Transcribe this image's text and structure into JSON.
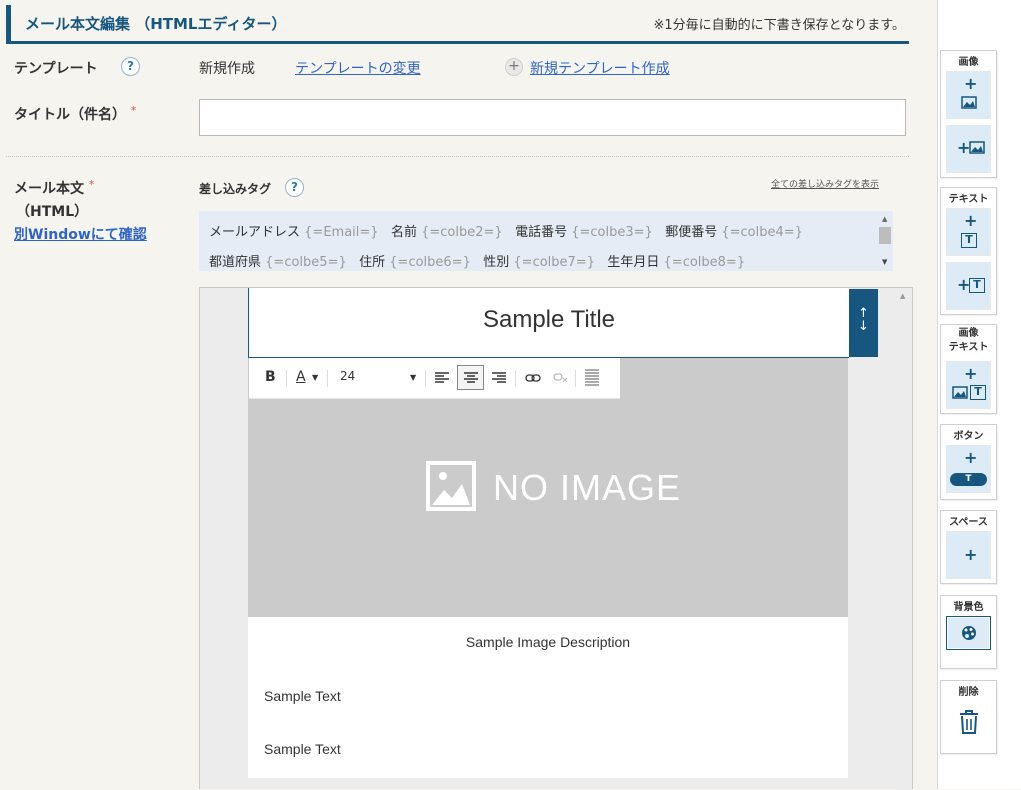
{
  "header": {
    "title": "メール本文編集 （HTMLエディター）",
    "note": "※1分毎に自動的に下書き保存となります。"
  },
  "template": {
    "label": "テンプレート",
    "current": "新規作成",
    "change_link": "テンプレートの変更",
    "new_link": "新規テンプレート作成"
  },
  "title_field": {
    "label": "タイトル（件名）",
    "required": "*",
    "value": ""
  },
  "body": {
    "label": "メール本文",
    "required": "*",
    "sublabel": "（HTML）",
    "preview_link": "別Windowにて確認",
    "tags_label": "差し込みタグ",
    "show_all_link": "全ての差し込みタグを表示",
    "tags": [
      {
        "name": "メールアドレス",
        "code": "{=Email=}"
      },
      {
        "name": "名前",
        "code": "{=colbe2=}"
      },
      {
        "name": "電話番号",
        "code": "{=colbe3=}"
      },
      {
        "name": "郵便番号",
        "code": "{=colbe4=}"
      },
      {
        "name": "都道府県",
        "code": "{=colbe5=}"
      },
      {
        "name": "住所",
        "code": "{=colbe6=}"
      },
      {
        "name": "性別",
        "code": "{=colbe7=}"
      },
      {
        "name": "生年月日",
        "code": "{=colbe8=}"
      }
    ]
  },
  "editor": {
    "sample_title": "Sample Title",
    "font_size": "24",
    "no_image": "NO IMAGE",
    "image_description": "Sample Image Description",
    "sample_text_1": "Sample Text",
    "sample_text_2": "Sample Text"
  },
  "rail": {
    "image": "画像",
    "text": "テキスト",
    "image_text_1": "画像",
    "image_text_2": "テキスト",
    "button": "ボタン",
    "space": "スペース",
    "background": "背景色",
    "delete": "削除"
  },
  "colors": {
    "accent": "#17567e",
    "link": "#2f64c6",
    "tile": "#dcebf5",
    "required": "#e24a3b"
  }
}
